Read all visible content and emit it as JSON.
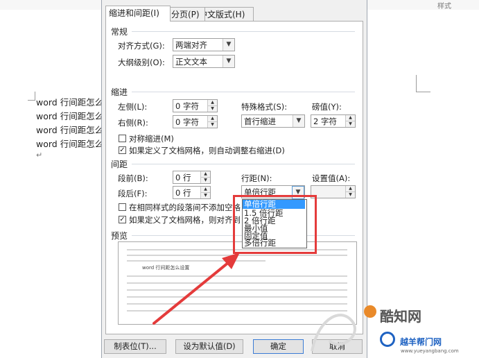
{
  "ribbon": {
    "styles_label": "样式"
  },
  "document": {
    "lines": [
      "word 行间距怎么",
      "word 行间距怎么",
      "word 行间距怎么",
      "word 行间距怎么"
    ],
    "paragraph_mark": "↵"
  },
  "dialog": {
    "tabs": [
      {
        "label": "缩进和间距(I)",
        "active": true
      },
      {
        "label": "换行和分页(P)",
        "active": false
      },
      {
        "label": "中文版式(H)",
        "active": false
      }
    ],
    "general": {
      "title": "常规",
      "alignment_label": "对齐方式(G):",
      "alignment_value": "两端对齐",
      "outline_label": "大纲级别(O):",
      "outline_value": "正文文本"
    },
    "indent": {
      "title": "缩进",
      "left_label": "左侧(L):",
      "left_value": "0 字符",
      "right_label": "右侧(R):",
      "right_value": "0 字符",
      "special_label": "特殊格式(S):",
      "special_value": "首行缩进",
      "by_label": "磅值(Y):",
      "by_value": "2 字符",
      "mirror_label": "对称缩进(M)",
      "mirror_checked": false,
      "grid_label": "如果定义了文档网格，则自动调整右缩进(D)",
      "grid_checked": true
    },
    "spacing": {
      "title": "间距",
      "before_label": "段前(B):",
      "before_value": "0 行",
      "after_label": "段后(F):",
      "after_value": "0 行",
      "line_label": "行距(N):",
      "line_value": "单倍行距",
      "at_label": "设置值(A):",
      "at_value": "",
      "no_space_label": "在相同样式的段落间不添加空格",
      "no_space_checked": false,
      "snap_label": "如果定义了文档网格，则对齐到",
      "snap_checked": true
    },
    "line_spacing_options": [
      "单倍行距",
      "1.5 倍行距",
      "2 倍行距",
      "最小值",
      "固定值",
      "多倍行距"
    ],
    "preview": {
      "title": "预览",
      "sample_text": "word 行间距怎么设置"
    },
    "buttons": {
      "tabs": "制表位(T)...",
      "set_default": "设为默认值(D)",
      "ok": "确定",
      "cancel": "取消"
    }
  },
  "watermark": {
    "logo": "酷知网",
    "subtitle": "越羊帮门网",
    "url": "www.yueyangbang.com"
  },
  "colors": {
    "highlight": "#3399ff",
    "annotation_red": "#e43b3b"
  }
}
